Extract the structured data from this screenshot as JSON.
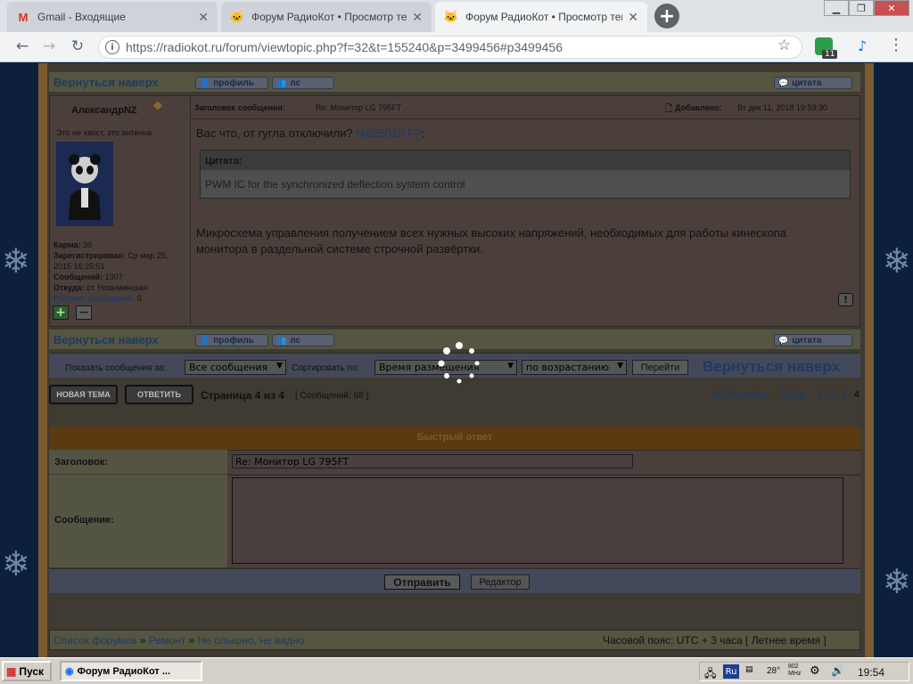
{
  "browser": {
    "tabs": [
      {
        "title": "Gmail - Входящие",
        "icon": "gmail-icon"
      },
      {
        "title": "Форум РадиоКот • Просмотр темы",
        "icon": "radiokot-cat-icon"
      },
      {
        "title": "Форум РадиоКот • Просмотр темы",
        "icon": "radiokot-cat-icon"
      }
    ],
    "url": "https://radiokot.ru/forum/viewtopic.php?f=32&t=155240&p=3499456#p3499456",
    "extension_badge": "11"
  },
  "post": {
    "back_to_top": "Вернуться наверх",
    "profile_label": "профиль",
    "pm_label": "лс",
    "quote_label": "цитата",
    "author": "АлександрNZ",
    "author_status": "Это не хвост, это антенна",
    "subject_label": "Заголовок сообщения:",
    "subject": "Re: Монитор LG 795FT",
    "added_label": "Добавлено:",
    "added_date": "Вт дек 11, 2018 19:59:30",
    "body_intro": "Вас что, от гугла отключили?",
    "body_link": "M62501P,FP",
    "body_colon": ":",
    "quote_header": "Цитата:",
    "quote_text": "PWM IC for the synchronized deflection system control",
    "body_main": "Микросхема управления получением всех нужных высоких напряжений, необходимых для работы кинескопа монитора в раздельной системе строчной развёртки.",
    "karma_label": "Карма:",
    "karma": "39",
    "registered_label": "Зарегистрирован:",
    "registered": "Ср мар 25, 2015 16:25:51",
    "posts_label": "Сообщений:",
    "posts": "1307",
    "from_label": "Откуда:",
    "from": "ст. Новоминская",
    "rating_label": "Рейтинг сообщения:",
    "rating": "0",
    "plus": "+",
    "minus": "−"
  },
  "sortbar": {
    "show_label": "Показать сообщения за:",
    "show_value": "Все сообщения",
    "sort_label": "Сортировать по:",
    "sort_value": "Время размещения",
    "order_value": "по возрастанию",
    "go_label": "Перейти",
    "back_to_top": "Вернуться наверх"
  },
  "pagination": {
    "new_topic": "НОВАЯ ТЕМА",
    "reply": "ОТВЕТИТЬ",
    "page_info": "Страница 4 из 4",
    "post_count": "[ Сообщений: 68 ]",
    "goto_label": "На страницу",
    "prev_label": "Пред.",
    "pages": [
      "1",
      "2",
      "3",
      "4"
    ]
  },
  "quick_reply": {
    "title": "Быстрый ответ",
    "subject_label": "Заголовок:",
    "subject_value": "Re: Монитор LG 795FT",
    "message_label": "Сообщение:",
    "submit": "Отправить",
    "editor": "Редактор"
  },
  "footer": {
    "breadcrumb": [
      "Список форумов",
      "Ремонт",
      "Не слышно, не видно"
    ],
    "breadcrumb_sep": "»",
    "timezone": "Часовой пояс: UTC + 3 часа [ Летнее время ]"
  },
  "taskbar": {
    "start": "Пуск",
    "task": "Форум РадиоКот ...",
    "lang": "Ru",
    "temp": "28°",
    "cpu": "802 MHz",
    "time": "19:54"
  }
}
